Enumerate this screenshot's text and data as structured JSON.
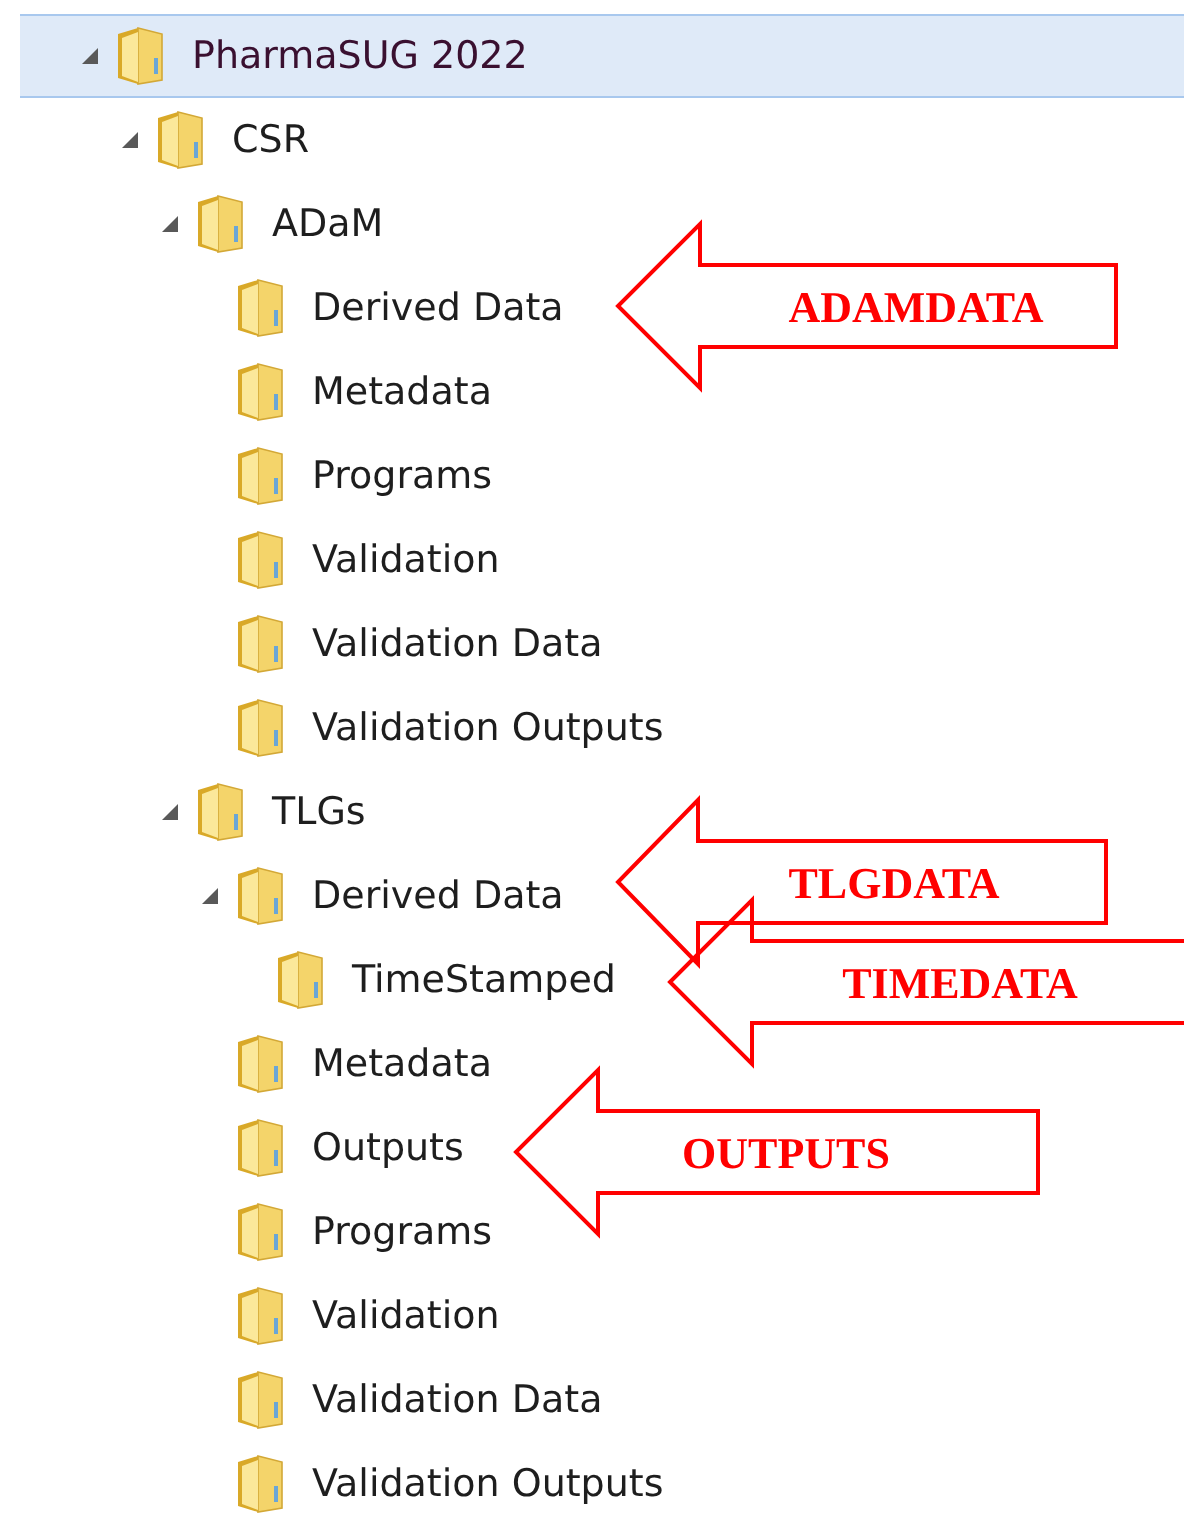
{
  "tree": [
    {
      "label": "PharmaSUG 2022",
      "selected": true,
      "expanded": true,
      "children": [
        {
          "label": "CSR",
          "selected": false,
          "expanded": true,
          "children": [
            {
              "label": "ADaM",
              "selected": false,
              "expanded": true,
              "children": [
                {
                  "label": "Derived Data",
                  "selected": false
                },
                {
                  "label": "Metadata",
                  "selected": false
                },
                {
                  "label": "Programs",
                  "selected": false
                },
                {
                  "label": "Validation",
                  "selected": false
                },
                {
                  "label": "Validation Data",
                  "selected": false
                },
                {
                  "label": "Validation Outputs",
                  "selected": false
                }
              ]
            },
            {
              "label": "TLGs",
              "selected": false,
              "expanded": true,
              "children": [
                {
                  "label": "Derived Data",
                  "selected": false,
                  "expanded": true,
                  "children": [
                    {
                      "label": "TimeStamped",
                      "selected": false
                    }
                  ]
                },
                {
                  "label": "Metadata",
                  "selected": false
                },
                {
                  "label": "Outputs",
                  "selected": false
                },
                {
                  "label": "Programs",
                  "selected": false
                },
                {
                  "label": "Validation",
                  "selected": false
                },
                {
                  "label": "Validation Data",
                  "selected": false
                },
                {
                  "label": "Validation Outputs",
                  "selected": false
                }
              ]
            }
          ]
        }
      ]
    }
  ],
  "annotations": [
    {
      "label": "ADAMDATA"
    },
    {
      "label": "TLGDATA"
    },
    {
      "label": "TIMEDATA"
    },
    {
      "label": "OUTPUTS"
    }
  ]
}
